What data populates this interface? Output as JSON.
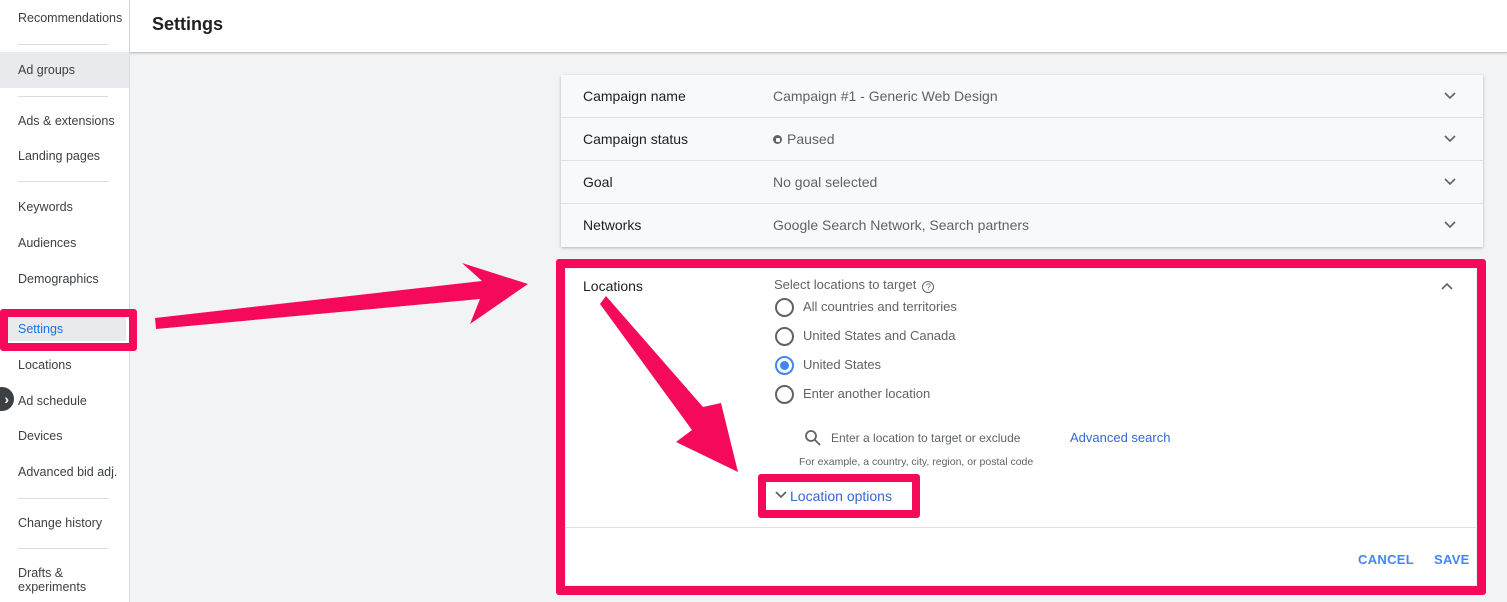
{
  "header": {
    "title": "Settings"
  },
  "sidebar": {
    "items": [
      {
        "label": "Recommendations"
      },
      {
        "label": "Ad groups"
      },
      {
        "label": "Ads & extensions"
      },
      {
        "label": "Landing pages"
      },
      {
        "label": "Keywords"
      },
      {
        "label": "Audiences"
      },
      {
        "label": "Demographics"
      },
      {
        "label": "Settings"
      },
      {
        "label": "Locations"
      },
      {
        "label": "Ad schedule"
      },
      {
        "label": "Devices"
      },
      {
        "label": "Advanced bid adj."
      },
      {
        "label": "Change history"
      },
      {
        "label": "Drafts &\nexperiments"
      }
    ],
    "collapse_glyph": "›"
  },
  "settings": {
    "rows": [
      {
        "label": "Campaign name",
        "value": "Campaign #1 - Generic Web Design"
      },
      {
        "label": "Campaign status",
        "value": "Paused"
      },
      {
        "label": "Goal",
        "value": "No goal selected"
      },
      {
        "label": "Networks",
        "value": "Google Search Network, Search partners"
      }
    ]
  },
  "locations": {
    "label": "Locations",
    "prompt": "Select locations to target",
    "help_glyph": "?",
    "options": [
      {
        "label": "All countries and territories",
        "selected": false
      },
      {
        "label": "United States and Canada",
        "selected": false
      },
      {
        "label": "United States",
        "selected": true
      },
      {
        "label": "Enter another location",
        "selected": false
      }
    ],
    "search_placeholder": "Enter a location to target or exclude",
    "advanced_search": "Advanced search",
    "hint": "For example, a country, city, region, or postal code",
    "location_options": "Location options",
    "cancel": "CANCEL",
    "save": "SAVE"
  },
  "colors": {
    "highlight": "#f50a5b",
    "link": "#3367d6",
    "primary": "#4285f4"
  }
}
